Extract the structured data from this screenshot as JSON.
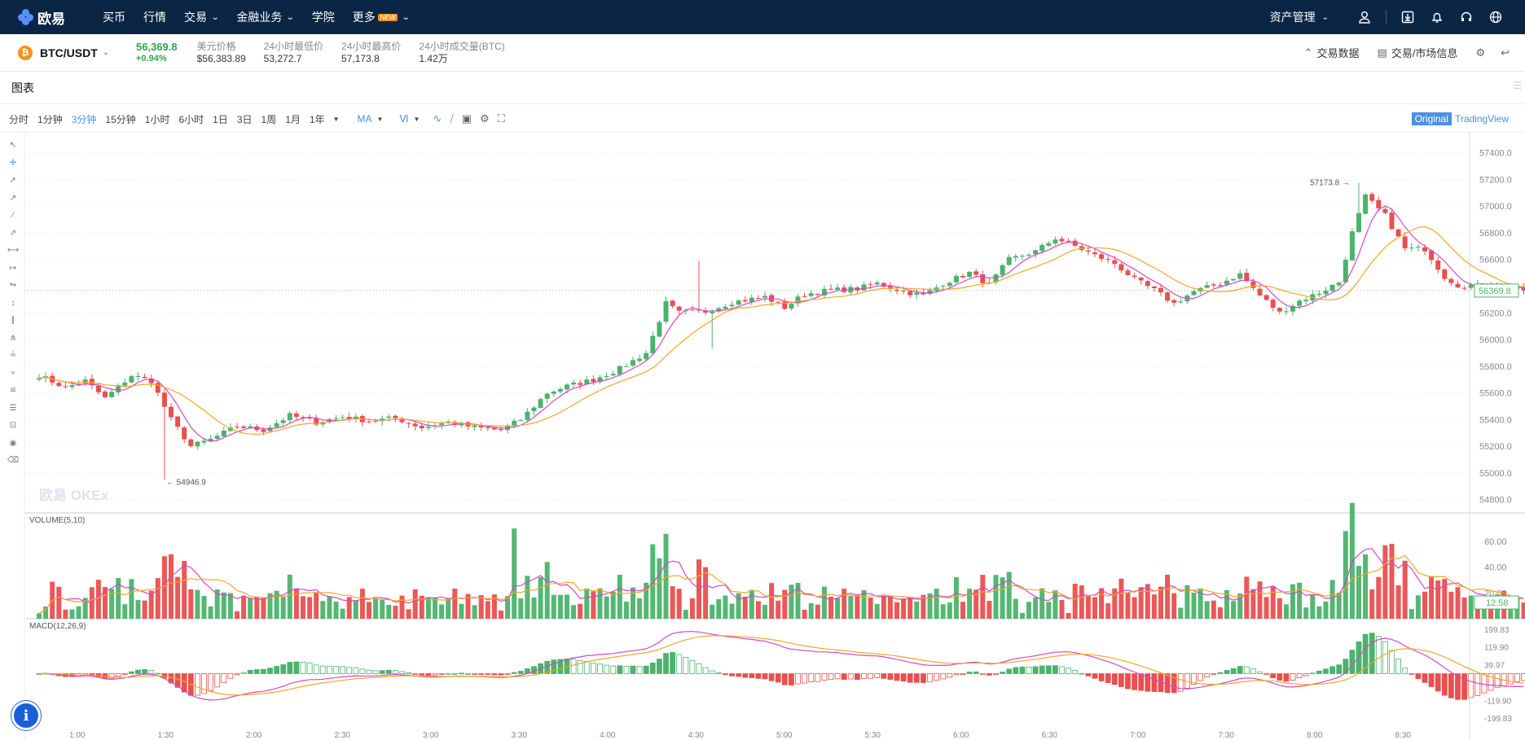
{
  "nav": {
    "brand": "欧易",
    "items": [
      {
        "label": "买币",
        "dropdown": false
      },
      {
        "label": "行情",
        "dropdown": false
      },
      {
        "label": "交易",
        "dropdown": true
      },
      {
        "label": "金融业务",
        "dropdown": true
      },
      {
        "label": "学院",
        "dropdown": false
      },
      {
        "label": "更多",
        "dropdown": true,
        "badge": "NEW"
      }
    ],
    "asset_label": "资产管理",
    "icons": [
      "user-icon",
      "download-icon",
      "bell-icon",
      "headset-icon",
      "globe-icon"
    ]
  },
  "ticker": {
    "pair": "BTC/USDT",
    "coin_symbol": "₿",
    "last_price": "56,369.8",
    "change": "+0.94%",
    "stats": [
      {
        "label": "美元价格",
        "value": "$56,383.89"
      },
      {
        "label": "24小时最低价",
        "value": "53,272.7"
      },
      {
        "label": "24小时最高价",
        "value": "57,173.8"
      },
      {
        "label": "24小时成交量(BTC)",
        "value": "1.42万"
      }
    ],
    "links": [
      "交易数据",
      "交易/市场信息"
    ]
  },
  "panel": {
    "title": "图表"
  },
  "toolbar": {
    "timeframes": [
      "分时",
      "1分钟",
      "3分钟",
      "15分钟",
      "1小时",
      "6小时",
      "1日",
      "3日",
      "1周",
      "1月",
      "1年"
    ],
    "active_timeframe": "3分钟",
    "indicator": "MA",
    "mode_on": "Original",
    "mode_off": "TradingView"
  },
  "colors": {
    "up": "#4bb36b",
    "down": "#e94f4f",
    "ma_fast": "#f5a623",
    "ma_slow": "#d348c9",
    "nav_bg": "#0b2545",
    "accent": "#4a90e2"
  },
  "chart_data": {
    "type": "candlestick",
    "watermark": "欧易 OKEx",
    "price_axis": {
      "ticks": [
        "57400.0",
        "57200.0",
        "57000.0",
        "56800.0",
        "56600.0",
        "56400.0",
        "56200.0",
        "56000.0",
        "55800.0",
        "55600.0",
        "55400.0",
        "55200.0",
        "55000.0",
        "54800.0"
      ],
      "range": [
        54700,
        57520
      ]
    },
    "last_price_label": "56369.8",
    "high_marker": {
      "label": "57173.8 →",
      "value": 57173.8
    },
    "low_marker": {
      "label": "← 54946.9",
      "value": 54946.9
    },
    "time_labels": [
      "1:00",
      "1:30",
      "2:00",
      "2:30",
      "3:00",
      "3:30",
      "4:00",
      "4:30",
      "5:00",
      "5:30",
      "6:00",
      "6:30",
      "7:00",
      "7:30",
      "8:00",
      "8:30"
    ],
    "anchors": [
      [
        0,
        55730
      ],
      [
        4,
        55640
      ],
      [
        7,
        55690
      ],
      [
        10,
        55560
      ],
      [
        14,
        55730
      ],
      [
        17,
        55690
      ],
      [
        20,
        55400
      ],
      [
        23,
        55200
      ],
      [
        26,
        55250
      ],
      [
        30,
        55350
      ],
      [
        34,
        55320
      ],
      [
        38,
        55430
      ],
      [
        42,
        55380
      ],
      [
        46,
        55420
      ],
      [
        50,
        55390
      ],
      [
        54,
        55410
      ],
      [
        58,
        55340
      ],
      [
        62,
        55380
      ],
      [
        66,
        55340
      ],
      [
        70,
        55320
      ],
      [
        73,
        55400
      ],
      [
        77,
        55600
      ],
      [
        80,
        55650
      ],
      [
        84,
        55700
      ],
      [
        88,
        55780
      ],
      [
        92,
        55900
      ],
      [
        95,
        56270
      ],
      [
        97,
        56200
      ],
      [
        101,
        56210
      ],
      [
        105,
        56280
      ],
      [
        110,
        56320
      ],
      [
        113,
        56240
      ],
      [
        116,
        56340
      ],
      [
        120,
        56370
      ],
      [
        124,
        56380
      ],
      [
        127,
        56420
      ],
      [
        131,
        56360
      ],
      [
        134,
        56330
      ],
      [
        137,
        56420
      ],
      [
        141,
        56500
      ],
      [
        144,
        56410
      ],
      [
        147,
        56600
      ],
      [
        151,
        56660
      ],
      [
        154,
        56760
      ],
      [
        157,
        56700
      ],
      [
        160,
        56630
      ],
      [
        163,
        56570
      ],
      [
        166,
        56450
      ],
      [
        169,
        56370
      ],
      [
        172,
        56270
      ],
      [
        175,
        56360
      ],
      [
        179,
        56420
      ],
      [
        182,
        56490
      ],
      [
        185,
        56330
      ],
      [
        188,
        56200
      ],
      [
        191,
        56290
      ],
      [
        194,
        56350
      ],
      [
        197,
        56430
      ],
      [
        199,
        56800
      ],
      [
        201,
        57070
      ],
      [
        204,
        56930
      ],
      [
        207,
        56680
      ],
      [
        210,
        56680
      ],
      [
        213,
        56470
      ],
      [
        216,
        56380
      ],
      [
        219,
        56420
      ],
      [
        222,
        56390
      ],
      [
        225,
        56370
      ]
    ],
    "volume": {
      "label": "VOLUME(5,10)",
      "ticks": [
        "60.00",
        "40.00",
        "20.00"
      ],
      "last_label": "12.58",
      "range": [
        0,
        72
      ]
    },
    "macd": {
      "label": "MACD(12,26,9)",
      "ticks": [
        "199.83",
        "119.90",
        "39.97",
        "-39.97",
        "-119.90",
        "-199.83"
      ],
      "range": [
        -210,
        210
      ]
    }
  }
}
